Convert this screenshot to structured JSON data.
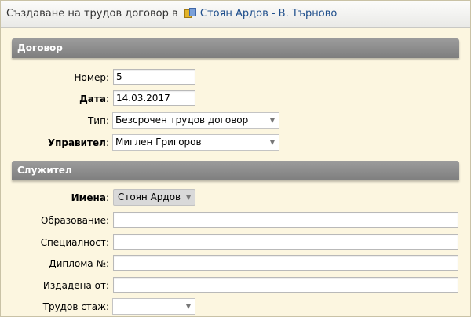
{
  "header": {
    "title_prefix": "Създаване на трудов договор в",
    "company_link": "Стоян Ардов - В. Търново",
    "company_icon": "company-icon"
  },
  "contract": {
    "section_title": "Договор",
    "number_label": "Номер",
    "number_value": "5",
    "date_label": "Дата",
    "date_value": "14.03.2017",
    "type_label": "Тип",
    "type_value": "Безсрочен трудов договор",
    "manager_label": "Управител",
    "manager_value": "Миглен Григоров"
  },
  "employee": {
    "section_title": "Служител",
    "name_label": "Имена",
    "name_value": "Стоян Ардов",
    "education_label": "Образование:",
    "education_value": "",
    "specialty_label": "Специалност:",
    "specialty_value": "",
    "diploma_label": "Диплома №:",
    "diploma_value": "",
    "issued_by_label": "Издадена от:",
    "issued_by_value": "",
    "seniority_label": "Трудов стаж:",
    "seniority_value": ""
  },
  "colors": {
    "background": "#fcf6e0",
    "section_header": "#8a8a8a",
    "link": "#1f4f8c"
  }
}
